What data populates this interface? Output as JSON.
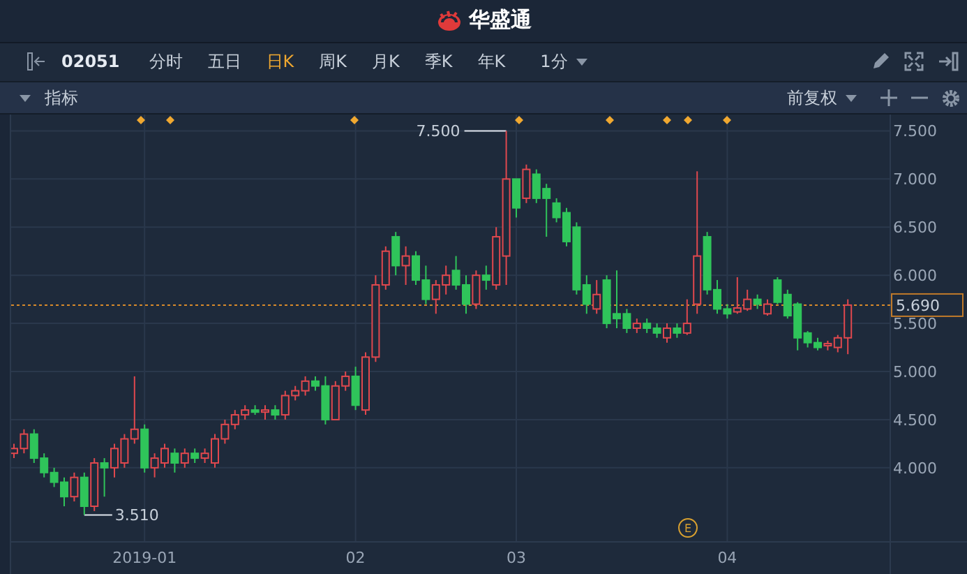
{
  "header": {
    "title": "华盛通"
  },
  "toolbar": {
    "symbol": "02051",
    "periods": [
      {
        "label": "分时",
        "selected": false
      },
      {
        "label": "五日",
        "selected": false
      },
      {
        "label": "日K",
        "selected": true
      },
      {
        "label": "周K",
        "selected": false
      },
      {
        "label": "月K",
        "selected": false
      },
      {
        "label": "季K",
        "selected": false
      },
      {
        "label": "年K",
        "selected": false
      }
    ],
    "interval": "1分"
  },
  "indicator_bar": {
    "label": "指标",
    "adjustment": "前复权"
  },
  "chart": {
    "event_badge": "E",
    "chart_data": {
      "type": "candlestick",
      "ylim": [
        3.23,
        7.67
      ],
      "yticks": [
        {
          "value": 7.5,
          "label": "7.500"
        },
        {
          "value": 7.0,
          "label": "7.000"
        },
        {
          "value": 6.5,
          "label": "6.500"
        },
        {
          "value": 6.0,
          "label": "6.000"
        },
        {
          "value": 5.5,
          "label": "5.500"
        },
        {
          "value": 5.0,
          "label": "5.000"
        },
        {
          "value": 4.5,
          "label": "4.500"
        },
        {
          "value": 4.0,
          "label": "4.000"
        }
      ],
      "categories": [
        null,
        null,
        null,
        null,
        null,
        null,
        null,
        null,
        null,
        null,
        null,
        null,
        null,
        "2019-01",
        null,
        null,
        null,
        null,
        null,
        null,
        null,
        null,
        null,
        null,
        null,
        null,
        null,
        null,
        null,
        null,
        null,
        null,
        null,
        null,
        "02",
        null,
        null,
        null,
        null,
        null,
        null,
        null,
        null,
        null,
        null,
        null,
        null,
        null,
        null,
        null,
        "03",
        null,
        null,
        null,
        null,
        null,
        null,
        null,
        null,
        null,
        null,
        null,
        null,
        null,
        null,
        null,
        null,
        null,
        null,
        null,
        null,
        "04",
        null,
        null,
        null,
        null,
        null,
        null,
        null,
        null,
        null,
        null,
        null,
        null
      ],
      "grid": true,
      "ref_lines": [
        {
          "axis": "y",
          "value": 5.69,
          "label": "5.690"
        }
      ],
      "annotations": [
        "7.500",
        "3.510"
      ],
      "ohlc": [
        [
          4.15,
          4.25,
          4.1,
          4.2
        ],
        [
          4.2,
          4.4,
          4.15,
          4.35
        ],
        [
          4.35,
          4.4,
          4.05,
          4.1
        ],
        [
          4.1,
          4.15,
          3.9,
          3.95
        ],
        [
          3.95,
          4.0,
          3.8,
          3.85
        ],
        [
          3.85,
          3.9,
          3.6,
          3.7
        ],
        [
          3.7,
          3.95,
          3.65,
          3.9
        ],
        [
          3.9,
          3.95,
          3.51,
          3.6
        ],
        [
          3.6,
          4.1,
          3.55,
          4.05
        ],
        [
          4.05,
          4.1,
          3.7,
          4.0
        ],
        [
          4.0,
          4.25,
          3.9,
          4.2
        ],
        [
          4.05,
          4.35,
          4.0,
          4.3
        ],
        [
          4.3,
          4.95,
          4.25,
          4.4
        ],
        [
          4.4,
          4.45,
          3.95,
          4.0
        ],
        [
          4.0,
          4.15,
          3.9,
          4.1
        ],
        [
          4.05,
          4.25,
          4.0,
          4.2
        ],
        [
          4.15,
          4.2,
          3.95,
          4.05
        ],
        [
          4.05,
          4.2,
          4.0,
          4.15
        ],
        [
          4.15,
          4.2,
          4.05,
          4.1
        ],
        [
          4.1,
          4.2,
          4.05,
          4.15
        ],
        [
          4.05,
          4.35,
          4.0,
          4.3
        ],
        [
          4.3,
          4.5,
          4.25,
          4.45
        ],
        [
          4.45,
          4.6,
          4.4,
          4.55
        ],
        [
          4.55,
          4.65,
          4.5,
          4.6
        ],
        [
          4.6,
          4.65,
          4.55,
          4.58
        ],
        [
          4.58,
          4.65,
          4.5,
          4.6
        ],
        [
          4.6,
          4.65,
          4.5,
          4.55
        ],
        [
          4.55,
          4.8,
          4.5,
          4.75
        ],
        [
          4.75,
          4.85,
          4.7,
          4.8
        ],
        [
          4.8,
          4.95,
          4.75,
          4.9
        ],
        [
          4.9,
          4.95,
          4.8,
          4.85
        ],
        [
          4.85,
          4.95,
          4.45,
          4.5
        ],
        [
          4.5,
          4.9,
          4.5,
          4.85
        ],
        [
          4.85,
          5.0,
          4.8,
          4.95
        ],
        [
          4.95,
          5.05,
          4.6,
          4.65
        ],
        [
          4.6,
          5.2,
          4.55,
          5.15
        ],
        [
          5.15,
          6.0,
          5.1,
          5.9
        ],
        [
          5.9,
          6.3,
          5.85,
          6.25
        ],
        [
          6.4,
          6.45,
          6.0,
          6.1
        ],
        [
          6.1,
          6.3,
          5.9,
          6.2
        ],
        [
          6.2,
          6.25,
          5.9,
          5.95
        ],
        [
          5.95,
          6.1,
          5.7,
          5.75
        ],
        [
          5.75,
          5.95,
          5.6,
          5.9
        ],
        [
          5.9,
          6.1,
          5.8,
          6.0
        ],
        [
          6.05,
          6.2,
          5.85,
          5.9
        ],
        [
          5.9,
          6.0,
          5.6,
          5.7
        ],
        [
          5.7,
          6.05,
          5.65,
          6.0
        ],
        [
          6.0,
          6.1,
          5.85,
          5.95
        ],
        [
          5.9,
          6.5,
          5.85,
          6.4
        ],
        [
          6.2,
          7.5,
          5.9,
          7.0
        ],
        [
          7.0,
          7.0,
          6.6,
          6.7
        ],
        [
          6.8,
          7.15,
          6.75,
          7.1
        ],
        [
          7.05,
          7.1,
          6.75,
          6.8
        ],
        [
          6.9,
          6.95,
          6.4,
          6.8
        ],
        [
          6.75,
          6.8,
          6.55,
          6.6
        ],
        [
          6.65,
          6.7,
          6.3,
          6.35
        ],
        [
          6.5,
          6.55,
          5.8,
          5.85
        ],
        [
          5.9,
          6.0,
          5.6,
          5.7
        ],
        [
          5.65,
          5.95,
          5.6,
          5.8
        ],
        [
          5.95,
          6.0,
          5.45,
          5.5
        ],
        [
          5.6,
          6.05,
          5.45,
          5.55
        ],
        [
          5.6,
          5.65,
          5.4,
          5.45
        ],
        [
          5.45,
          5.55,
          5.4,
          5.5
        ],
        [
          5.5,
          5.55,
          5.4,
          5.45
        ],
        [
          5.45,
          5.5,
          5.35,
          5.4
        ],
        [
          5.35,
          5.5,
          5.3,
          5.45
        ],
        [
          5.45,
          5.5,
          5.35,
          5.4
        ],
        [
          5.4,
          5.75,
          5.38,
          5.5
        ],
        [
          5.7,
          7.08,
          5.6,
          6.2
        ],
        [
          6.4,
          6.45,
          5.8,
          5.85
        ],
        [
          5.85,
          5.95,
          5.6,
          5.65
        ],
        [
          5.65,
          5.7,
          5.55,
          5.6
        ],
        [
          5.62,
          5.98,
          5.6,
          5.66
        ],
        [
          5.65,
          5.85,
          5.63,
          5.75
        ],
        [
          5.75,
          5.8,
          5.65,
          5.7
        ],
        [
          5.6,
          5.75,
          5.58,
          5.7
        ],
        [
          5.95,
          5.98,
          5.7,
          5.72
        ],
        [
          5.8,
          5.85,
          5.55,
          5.58
        ],
        [
          5.7,
          5.72,
          5.22,
          5.35
        ],
        [
          5.4,
          5.42,
          5.25,
          5.3
        ],
        [
          5.3,
          5.35,
          5.22,
          5.25
        ],
        [
          5.28,
          5.32,
          5.22,
          5.29
        ],
        [
          5.25,
          5.38,
          5.2,
          5.35
        ],
        [
          5.35,
          5.75,
          5.18,
          5.69
        ]
      ]
    }
  }
}
